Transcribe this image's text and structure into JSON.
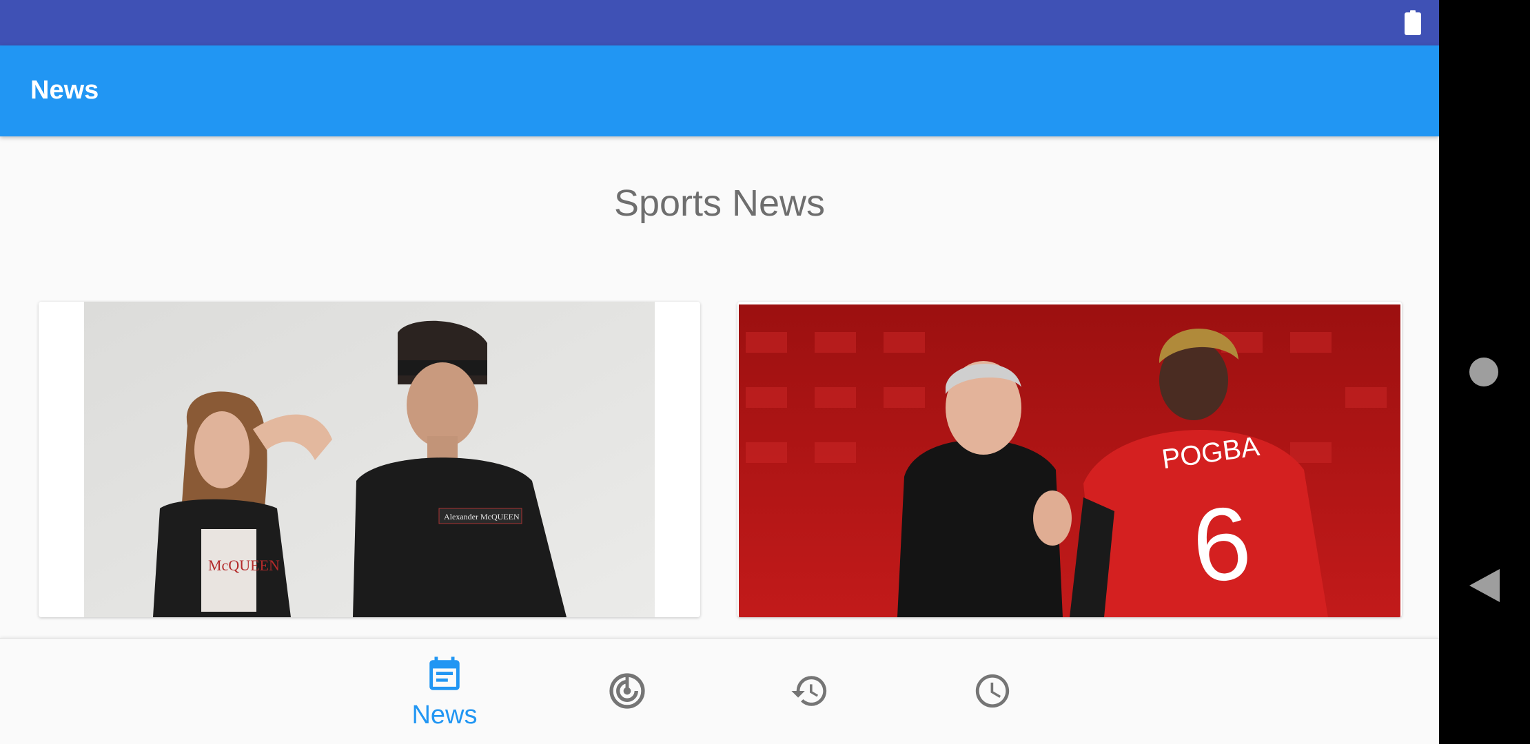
{
  "app_bar": {
    "title": "News"
  },
  "section": {
    "title": "Sports News"
  },
  "cards": [
    {
      "image": "news-photo-couple"
    },
    {
      "image": "news-photo-football-players"
    }
  ],
  "bottom_nav": {
    "items": [
      {
        "label": "News",
        "icon": "news-calendar-icon",
        "active": true
      },
      {
        "label": "",
        "icon": "radar-icon",
        "active": false
      },
      {
        "label": "",
        "icon": "history-icon",
        "active": false
      },
      {
        "label": "",
        "icon": "clock-icon",
        "active": false
      }
    ],
    "active_color": "#2196f3",
    "inactive_color": "#757575"
  },
  "colors": {
    "status_bar": "#3f51b5",
    "app_bar": "#2196f3",
    "background": "#fafafa"
  }
}
